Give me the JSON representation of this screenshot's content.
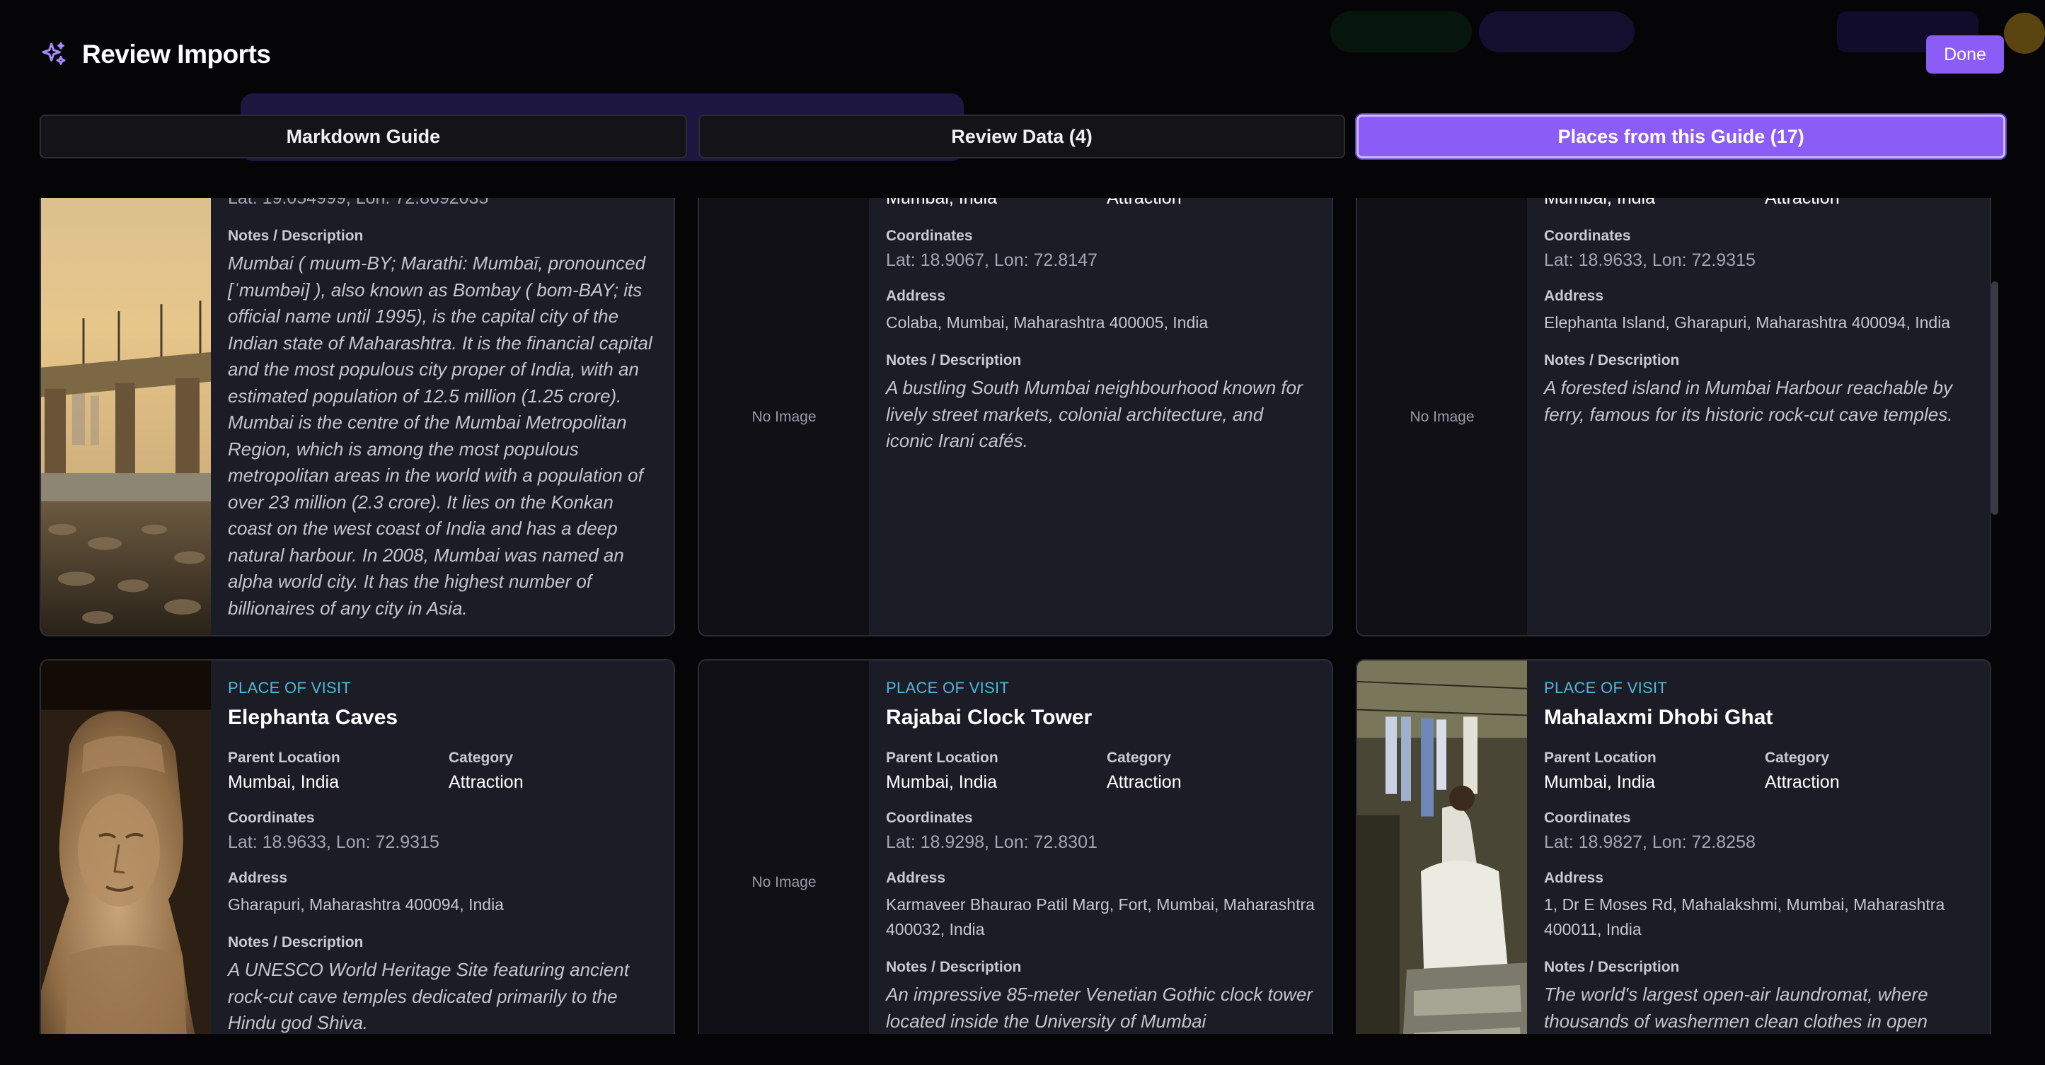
{
  "modal": {
    "title": "Review Imports",
    "done_label": "Done"
  },
  "tabs": [
    {
      "label": "Markdown Guide",
      "active": false
    },
    {
      "label": "Review Data (4)",
      "active": false
    },
    {
      "label": "Places from this Guide (17)",
      "active": true
    }
  ],
  "labels": {
    "kicker": "PLACE OF VISIT",
    "parent_location": "Parent Location",
    "category": "Category",
    "coordinates": "Coordinates",
    "address": "Address",
    "notes": "Notes / Description",
    "no_image": "No Image"
  },
  "top_cards": [
    {
      "coords_partial": "Lat: 19.054999, Lon: 72.8692035",
      "notes": "Mumbai ( muum-BY; Marathi: Mumbaī, pronounced [ˈmumbəi] ), also known as Bombay ( bom-BAY; its official name until 1995), is the capital city of the Indian state of Maharashtra. It is the financial capital and the most populous city proper of India, with an estimated population of 12.5 million (1.25 crore). Mumbai is the centre of the Mumbai Metropolitan Region, which is among the most populous metropolitan areas in the world with a population of over 23 million (2.3 crore). It lies on the Konkan coast on the west coast of India and has a deep natural harbour. In 2008, Mumbai was named an alpha world city. It has the highest number of billionaires of any city in Asia."
    },
    {
      "parent_partial": "Mumbai, India",
      "category_partial": "Attraction",
      "coords": "Lat: 18.9067, Lon: 72.8147",
      "address": "Colaba, Mumbai, Maharashtra 400005, India",
      "notes": "A bustling South Mumbai neighbourhood known for lively street markets, colonial architecture, and iconic Irani cafés."
    },
    {
      "parent_partial": "Mumbai, India",
      "category_partial": "Attraction",
      "coords": "Lat: 18.9633, Lon: 72.9315",
      "address": "Elephanta Island, Gharapuri, Maharashtra 400094, India",
      "notes": "A forested island in Mumbai Harbour reachable by ferry, famous for its historic rock-cut cave temples."
    }
  ],
  "bottom_cards": [
    {
      "name": "Elephanta Caves",
      "parent": "Mumbai, India",
      "category": "Attraction",
      "coords": "Lat: 18.9633, Lon: 72.9315",
      "address": "Gharapuri, Maharashtra 400094, India",
      "notes": "A UNESCO World Heritage Site featuring ancient rock-cut cave temples dedicated primarily to the Hindu god Shiva."
    },
    {
      "name": "Rajabai Clock Tower",
      "parent": "Mumbai, India",
      "category": "Attraction",
      "coords": "Lat: 18.9298, Lon: 72.8301",
      "address": "Karmaveer Bhaurao Patil Marg, Fort, Mumbai, Maharashtra 400032, India",
      "notes": "An impressive 85-meter Venetian Gothic clock tower located inside the University of Mumbai"
    },
    {
      "name": "Mahalaxmi Dhobi Ghat",
      "parent": "Mumbai, India",
      "category": "Attraction",
      "coords": "Lat: 18.9827, Lon: 72.8258",
      "address": "1, Dr E Moses Rd, Mahalakshmi, Mumbai, Maharashtra 400011, India",
      "notes": "The world's largest open-air laundromat, where thousands of washermen clean clothes in open"
    }
  ],
  "colors": {
    "accent": "#8b5cf6",
    "kicker": "#4fb8d8",
    "card_bg": "#1c1c27",
    "backdrop": "#050508"
  }
}
